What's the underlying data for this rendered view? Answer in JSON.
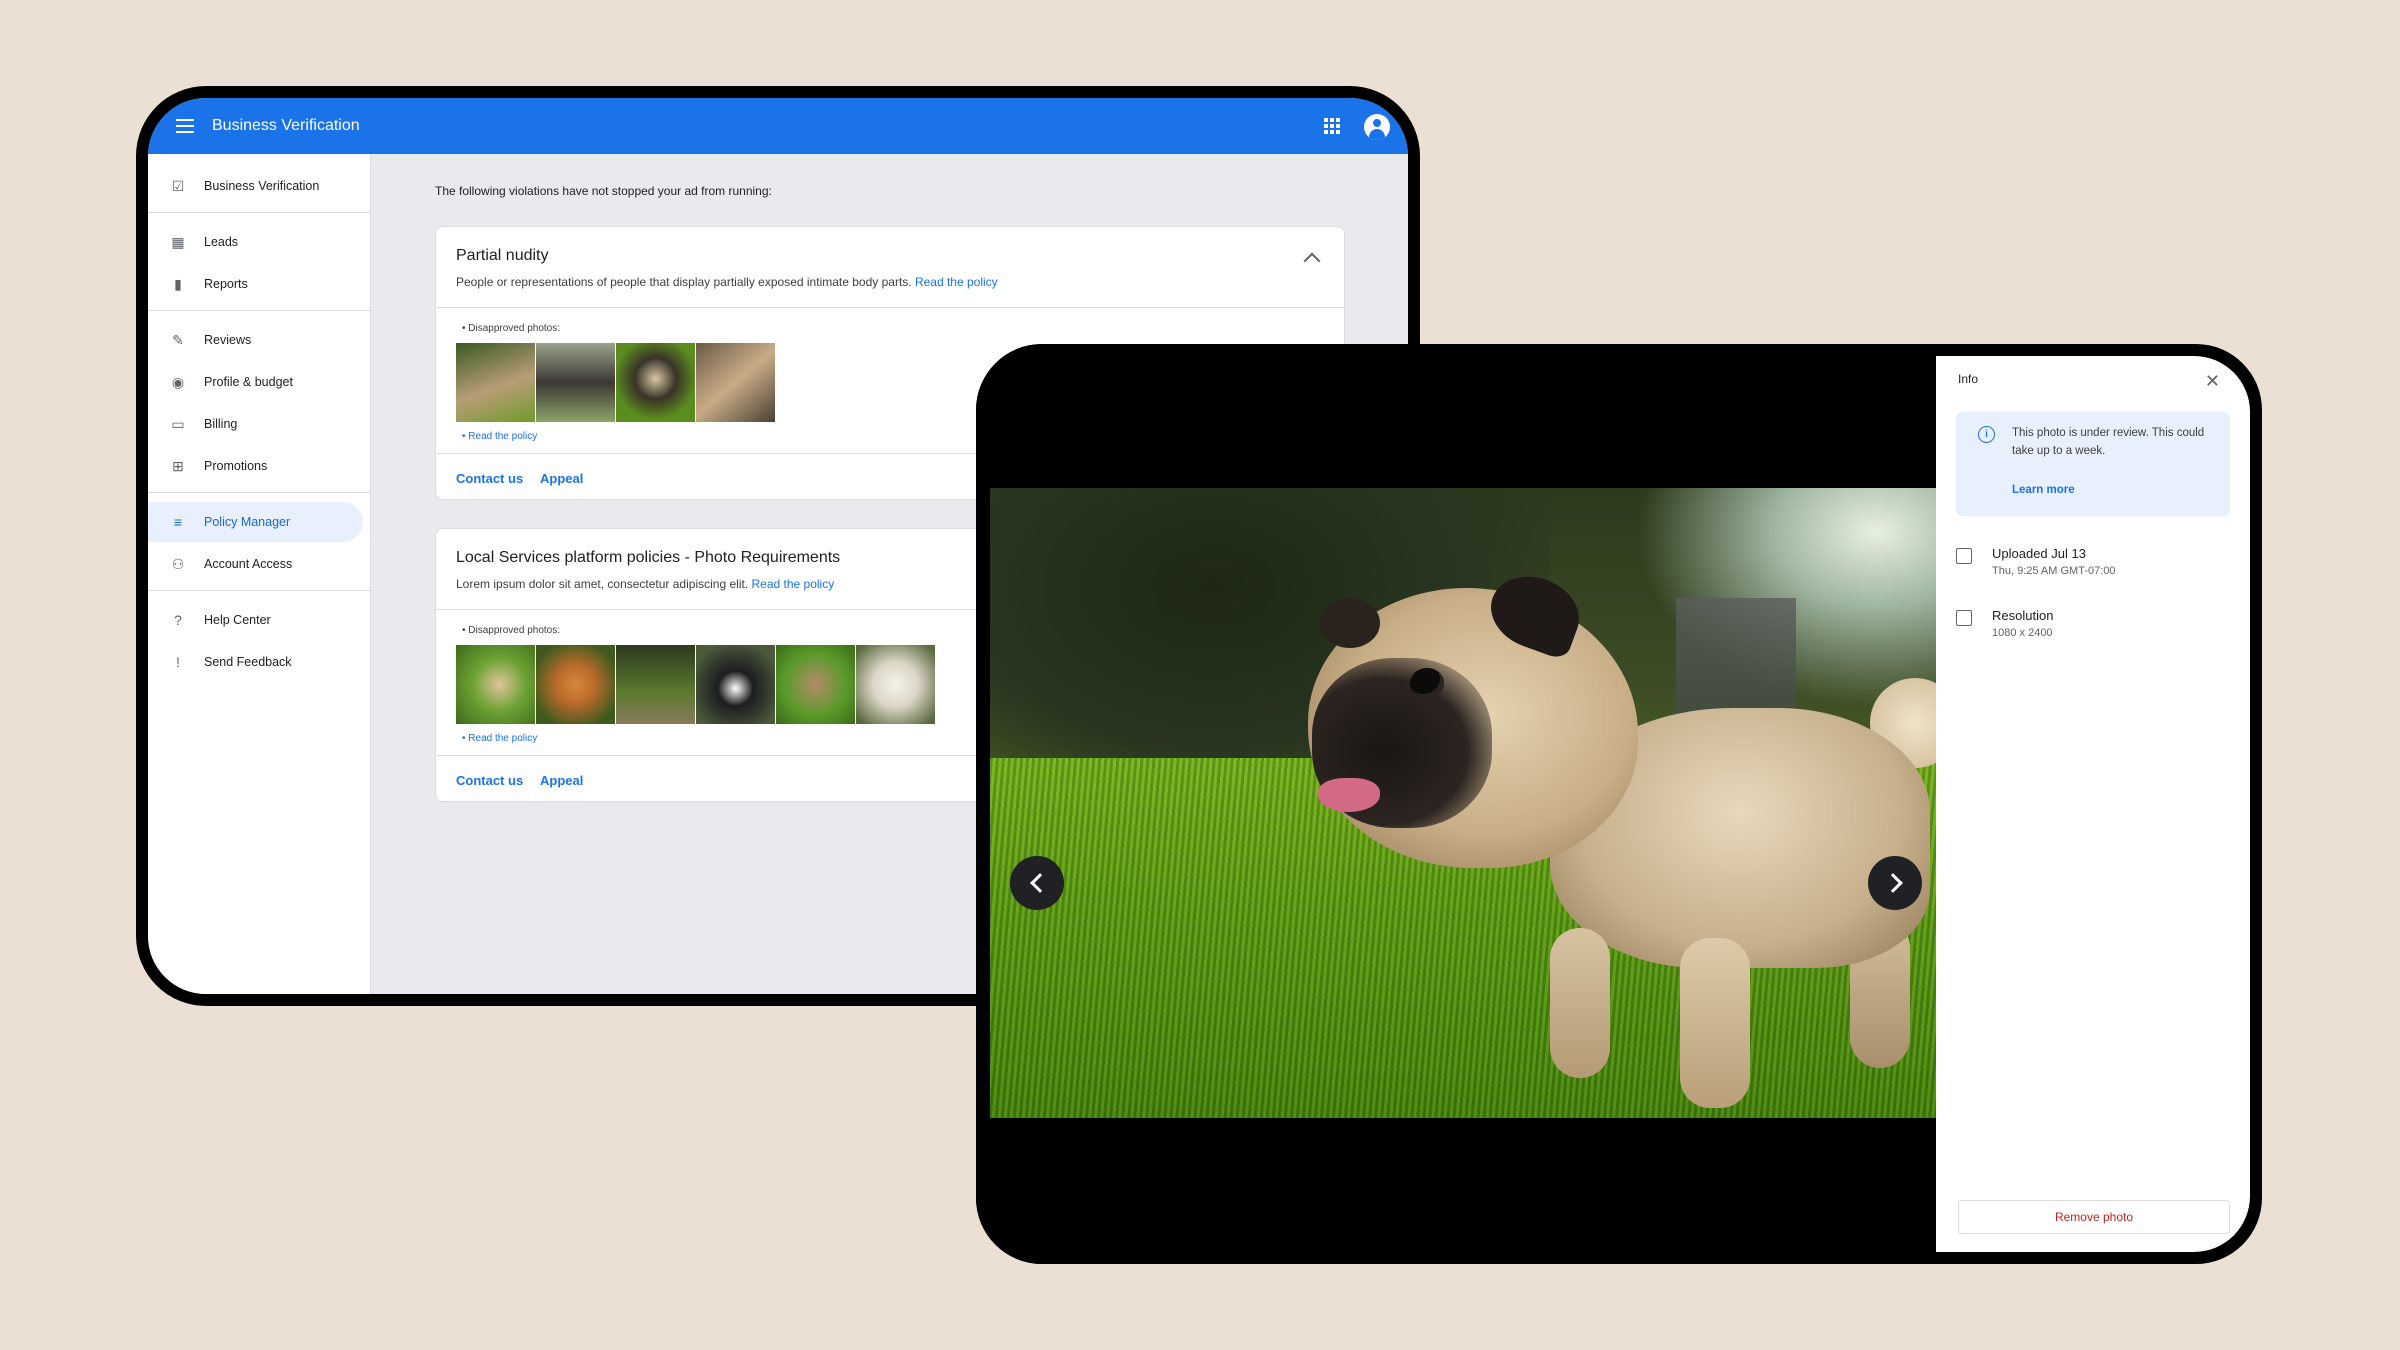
{
  "app": {
    "title": "Business Verification"
  },
  "sidebar": {
    "items": [
      {
        "label": "Business Verification",
        "icon": "verified-icon"
      },
      {
        "label": "Leads",
        "icon": "calendar-icon"
      },
      {
        "label": "Reports",
        "icon": "bar-chart-icon"
      },
      {
        "label": "Reviews",
        "icon": "rate-review-icon"
      },
      {
        "label": "Profile & budget",
        "icon": "person-icon"
      },
      {
        "label": "Billing",
        "icon": "billing-icon"
      },
      {
        "label": "Promotions",
        "icon": "gift-icon"
      },
      {
        "label": "Policy Manager",
        "icon": "policy-icon",
        "active": true
      },
      {
        "label": "Account Access",
        "icon": "account-access-icon"
      },
      {
        "label": "Help Center",
        "icon": "help-icon"
      },
      {
        "label": "Send Feedback",
        "icon": "feedback-icon"
      }
    ]
  },
  "main": {
    "intro": "The following violations have not stopped your ad from running:",
    "cards": [
      {
        "title": "Partial nudity",
        "description": "People or representations of people that display partially exposed intimate body parts.",
        "policy_link": "Read the policy",
        "disapproved_label": "Disapproved photos:",
        "read_policy": "Read the policy",
        "contact": "Contact us",
        "appeal": "Appeal"
      },
      {
        "title": "Local Services platform policies - Photo Requirements",
        "description": "Lorem ipsum dolor sit amet, consectetur adipiscing elit.",
        "policy_link": "Read the policy",
        "disapproved_label": "Disapproved photos:",
        "read_policy": "Read the policy",
        "contact": "Contact us",
        "appeal": "Appeal"
      }
    ]
  },
  "info": {
    "title": "Info",
    "notice": "This photo is under review. This could take up to a week.",
    "learn_more": "Learn more",
    "uploaded_label": "Uploaded Jul 13",
    "uploaded_time": "Thu, 9:25 AM GMT-07:00",
    "resolution_label": "Resolution",
    "resolution_value": "1080 x 2400",
    "remove": "Remove photo"
  },
  "colors": {
    "accent": "#1a73e8",
    "background": "#ece0d5",
    "danger": "#c5221f"
  }
}
